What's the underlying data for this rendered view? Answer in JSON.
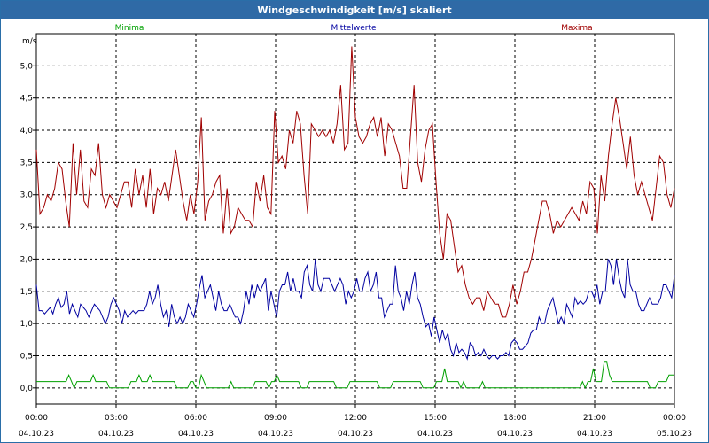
{
  "window": {
    "title": "Windgeschwindigkeit [m/s] skaliert"
  },
  "colors": {
    "min": "#00a000",
    "mean": "#0000a0",
    "max": "#a00000",
    "grid": "#000000"
  },
  "chart_data": {
    "type": "line",
    "title": "Windgeschwindigkeit [m/s] skaliert",
    "ylabel": "m/s",
    "ylim": [
      -0.25,
      5.5
    ],
    "yticks": [
      "0,0",
      "0,5",
      "1,0",
      "1,5",
      "2,0",
      "2,5",
      "3,0",
      "3,5",
      "4,0",
      "4,5",
      "5,0"
    ],
    "xlim_hours": [
      0,
      24
    ],
    "xticks": [
      {
        "time": "00:00",
        "date": "04.10.23"
      },
      {
        "time": "03:00",
        "date": "04.10.23"
      },
      {
        "time": "06:00",
        "date": "04.10.23"
      },
      {
        "time": "09:00",
        "date": "04.10.23"
      },
      {
        "time": "12:00",
        "date": "04.10.23"
      },
      {
        "time": "15:00",
        "date": "04.10.23"
      },
      {
        "time": "18:00",
        "date": "04.10.23"
      },
      {
        "time": "21:00",
        "date": "04.10.23"
      },
      {
        "time": "00:00",
        "date": "05.10.23"
      }
    ],
    "grid": true,
    "legend_position": "top",
    "series": [
      {
        "name": "Minima",
        "color": "#00a000",
        "values": [
          0.1,
          0.1,
          0.1,
          0.1,
          0.1,
          0.1,
          0.1,
          0.1,
          0.1,
          0.1,
          0.1,
          0.1,
          0.2,
          0.1,
          0,
          0.1,
          0.1,
          0.1,
          0.1,
          0.1,
          0.1,
          0.2,
          0.1,
          0.1,
          0.1,
          0.1,
          0.1,
          0,
          0,
          0,
          0,
          0,
          0,
          0,
          0,
          0.1,
          0.1,
          0.1,
          0.2,
          0.1,
          0.1,
          0.1,
          0.2,
          0.1,
          0.1,
          0.1,
          0.1,
          0.1,
          0.1,
          0.1,
          0.1,
          0.1,
          0,
          0,
          0,
          0,
          0,
          0.1,
          0.1,
          0,
          0,
          0.2,
          0.1,
          0,
          0,
          0,
          0,
          0,
          0,
          0,
          0,
          0,
          0.1,
          0,
          0,
          0,
          0,
          0,
          0,
          0,
          0,
          0.1,
          0.1,
          0.1,
          0.1,
          0.1,
          0,
          0.1,
          0.1,
          0.2,
          0.1,
          0.1,
          0.1,
          0.1,
          0.1,
          0.1,
          0.1,
          0.1,
          0,
          0,
          0,
          0.1,
          0.1,
          0.1,
          0.1,
          0.1,
          0.1,
          0.1,
          0.1,
          0.1,
          0.1,
          0,
          0,
          0,
          0,
          0,
          0.1,
          0.1,
          0.1,
          0.1,
          0.1,
          0.1,
          0.1,
          0.1,
          0.1,
          0.1,
          0.1,
          0,
          0,
          0,
          0,
          0,
          0.1,
          0.1,
          0.1,
          0.1,
          0.1,
          0.1,
          0.1,
          0.1,
          0.1,
          0.1,
          0.1,
          0,
          0,
          0,
          0,
          0,
          0.1,
          0.1,
          0.1,
          0.3,
          0.1,
          0.1,
          0.1,
          0.1,
          0.1,
          0,
          0.1,
          0,
          0,
          0,
          0,
          0,
          0,
          0.1,
          0,
          0,
          0,
          0,
          0,
          0,
          0,
          0,
          0,
          0,
          0,
          0,
          0,
          0,
          0,
          0,
          0,
          0,
          0,
          0,
          0,
          0,
          0,
          0,
          0,
          0,
          0,
          0,
          0,
          0,
          0,
          0,
          0,
          0,
          0,
          0,
          0.1,
          0,
          0.1,
          0.1,
          0.3,
          0.1,
          0.1,
          0.1,
          0.4,
          0.4,
          0.2,
          0.1,
          0.1,
          0.1,
          0.1,
          0.1,
          0.1,
          0.1,
          0.1,
          0.1,
          0.1,
          0.1,
          0.1,
          0.1,
          0.1,
          0,
          0,
          0,
          0.1,
          0.1,
          0.1,
          0.1,
          0.2,
          0.2,
          0.2
        ]
      },
      {
        "name": "Mittelwerte",
        "color": "#0000a0",
        "values": [
          1.6,
          1.2,
          1.2,
          1.15,
          1.2,
          1.25,
          1.15,
          1.3,
          1.4,
          1.25,
          1.3,
          1.5,
          1.15,
          1.3,
          1.2,
          1.1,
          1.3,
          1.25,
          1.2,
          1.1,
          1.2,
          1.3,
          1.25,
          1.2,
          1.1,
          1.0,
          1.1,
          1.3,
          1.4,
          1.3,
          1.2,
          1.0,
          1.2,
          1.1,
          1.15,
          1.2,
          1.15,
          1.2,
          1.2,
          1.2,
          1.3,
          1.5,
          1.3,
          1.4,
          1.6,
          1.3,
          1.1,
          1.2,
          0.95,
          1.3,
          1.1,
          1.0,
          1.1,
          1.0,
          1.1,
          1.3,
          1.2,
          1.1,
          1.3,
          1.55,
          1.75,
          1.4,
          1.5,
          1.6,
          1.4,
          1.2,
          1.5,
          1.3,
          1.2,
          1.2,
          1.3,
          1.2,
          1.1,
          1.1,
          1.0,
          1.2,
          1.5,
          1.3,
          1.6,
          1.4,
          1.6,
          1.5,
          1.6,
          1.7,
          1.2,
          1.5,
          1.3,
          1.1,
          1.5,
          1.6,
          1.6,
          1.8,
          1.5,
          1.7,
          1.5,
          1.5,
          1.4,
          1.8,
          1.9,
          1.6,
          1.5,
          2.0,
          1.6,
          1.5,
          1.7,
          1.7,
          1.7,
          1.6,
          1.5,
          1.6,
          1.7,
          1.6,
          1.3,
          1.5,
          1.4,
          1.5,
          1.7,
          1.5,
          1.5,
          1.7,
          1.8,
          1.5,
          1.6,
          1.8,
          1.4,
          1.4,
          1.1,
          1.2,
          1.3,
          1.3,
          1.9,
          1.5,
          1.4,
          1.2,
          1.5,
          1.3,
          1.6,
          1.8,
          1.4,
          1.3,
          1.1,
          0.95,
          1.0,
          0.8,
          1.1,
          0.9,
          0.7,
          0.9,
          0.75,
          0.85,
          0.6,
          0.5,
          0.7,
          0.55,
          0.6,
          0.55,
          0.45,
          0.7,
          0.65,
          0.5,
          0.55,
          0.5,
          0.6,
          0.5,
          0.45,
          0.5,
          0.5,
          0.45,
          0.5,
          0.5,
          0.55,
          0.5,
          0.7,
          0.75,
          0.7,
          0.6,
          0.6,
          0.65,
          0.7,
          0.85,
          0.9,
          0.9,
          1.1,
          1.0,
          1.0,
          1.2,
          1.3,
          1.4,
          1.2,
          1.0,
          1.1,
          1.0,
          1.3,
          1.2,
          1.1,
          1.4,
          1.3,
          1.35,
          1.3,
          1.35,
          1.5,
          1.5,
          1.4,
          1.6,
          1.3,
          1.5,
          1.5,
          2.0,
          1.9,
          1.6,
          2.0,
          1.7,
          1.5,
          1.4,
          2.0,
          1.6,
          1.5,
          1.5,
          1.3,
          1.2,
          1.2,
          1.3,
          1.4,
          1.3,
          1.3,
          1.3,
          1.4,
          1.6,
          1.6,
          1.5,
          1.4,
          1.75
        ]
      },
      {
        "name": "Maxima",
        "color": "#a00000",
        "values": [
          3.7,
          2.7,
          2.8,
          3.0,
          2.9,
          3.1,
          3.5,
          3.4,
          2.9,
          2.5,
          3.8,
          3.0,
          3.7,
          2.9,
          2.8,
          3.4,
          3.3,
          3.8,
          3.0,
          2.8,
          3.0,
          2.9,
          2.8,
          3.0,
          3.2,
          3.2,
          2.8,
          3.4,
          3.0,
          3.3,
          2.8,
          3.4,
          2.7,
          3.1,
          3.0,
          3.2,
          2.9,
          3.3,
          3.7,
          3.3,
          2.9,
          2.6,
          3.0,
          2.7,
          3.2,
          4.2,
          2.6,
          2.9,
          3.0,
          3.2,
          3.3,
          2.4,
          3.1,
          2.4,
          2.5,
          2.8,
          2.7,
          2.6,
          2.6,
          2.5,
          3.2,
          2.9,
          3.3,
          2.8,
          2.7,
          4.3,
          3.5,
          3.6,
          3.4,
          4.0,
          3.8,
          4.3,
          4.1,
          3.3,
          2.7,
          4.1,
          4.0,
          3.9,
          4.0,
          3.9,
          4.0,
          3.8,
          4.1,
          4.7,
          3.7,
          3.8,
          5.3,
          4.2,
          3.9,
          3.8,
          3.9,
          4.1,
          4.2,
          3.9,
          4.2,
          3.6,
          4.1,
          4.0,
          3.8,
          3.6,
          3.1,
          3.1,
          3.9,
          4.7,
          3.5,
          3.2,
          3.7,
          4.0,
          4.1,
          3.2,
          2.4,
          2.0,
          2.7,
          2.6,
          2.2,
          1.8,
          1.9,
          1.6,
          1.4,
          1.3,
          1.4,
          1.4,
          1.2,
          1.5,
          1.4,
          1.3,
          1.3,
          1.1,
          1.1,
          1.3,
          1.6,
          1.3,
          1.5,
          1.8,
          1.8,
          2.0,
          2.3,
          2.6,
          2.9,
          2.9,
          2.7,
          2.4,
          2.6,
          2.5,
          2.6,
          2.7,
          2.8,
          2.7,
          2.6,
          2.9,
          2.7,
          3.2,
          3.1,
          2.4,
          3.3,
          2.9,
          3.6,
          4.1,
          4.5,
          4.2,
          3.8,
          3.4,
          3.9,
          3.3,
          3.0,
          3.2,
          3.0,
          2.8,
          2.6,
          3.1,
          3.6,
          3.5,
          3.0,
          2.8,
          3.1
        ]
      }
    ]
  }
}
